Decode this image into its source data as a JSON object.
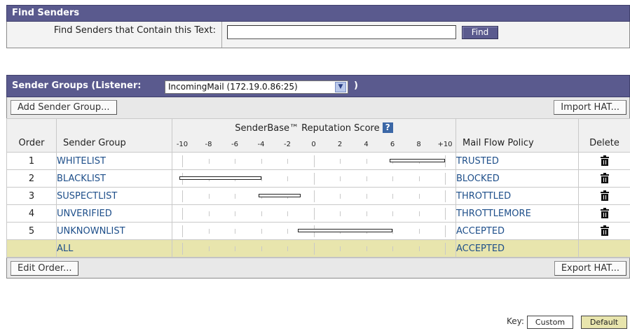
{
  "find_senders": {
    "title": "Find Senders",
    "label": "Find Senders that Contain this Text:",
    "input_value": "",
    "button": "Find"
  },
  "sender_groups": {
    "title": "Sender Groups (Listener:",
    "listener_selected": "IncomingMail (172.19.0.86:25)",
    "title_suffix": ")",
    "add_button": "Add Sender Group...",
    "import_button": "Import HAT...",
    "edit_button": "Edit Order...",
    "export_button": "Export HAT...",
    "columns": {
      "order": "Order",
      "group": "Sender Group",
      "score": "SenderBase™ Reputation Score",
      "help": "?",
      "policy": "Mail Flow Policy",
      "delete": "Delete"
    },
    "scale_labels": [
      "-10",
      "-8",
      "-6",
      "-4",
      "-2",
      "0",
      "2",
      "4",
      "6",
      "8",
      "+10"
    ],
    "rows": [
      {
        "order": "1",
        "group": "WHITELIST",
        "policy": "TRUSTED",
        "score_range": [
          6,
          10
        ],
        "deletable": true,
        "is_default": false
      },
      {
        "order": "2",
        "group": "BLACKLIST",
        "policy": "BLOCKED",
        "score_range": [
          -10,
          -4
        ],
        "deletable": true,
        "is_default": false
      },
      {
        "order": "3",
        "group": "SUSPECTLIST",
        "policy": "THROTTLED",
        "score_range": [
          -4,
          -1
        ],
        "deletable": true,
        "is_default": false
      },
      {
        "order": "4",
        "group": "UNVERIFIED",
        "policy": "THROTTLEMORE",
        "score_range": null,
        "deletable": true,
        "is_default": false
      },
      {
        "order": "5",
        "group": "UNKNOWNLIST",
        "policy": "ACCEPTED",
        "score_range": [
          -1,
          6
        ],
        "deletable": true,
        "is_default": false
      },
      {
        "order": "",
        "group": "ALL",
        "policy": "ACCEPTED",
        "score_range": null,
        "deletable": false,
        "is_default": true
      }
    ]
  },
  "key": {
    "label": "Key:",
    "custom": "Custom",
    "default": "Default",
    "custom_color": "#ffffff",
    "default_color": "#e8e5ad"
  },
  "colors": {
    "header_bg": "#5a5a8e",
    "link": "#1e4f8a",
    "default_row": "#e8e5ad"
  }
}
